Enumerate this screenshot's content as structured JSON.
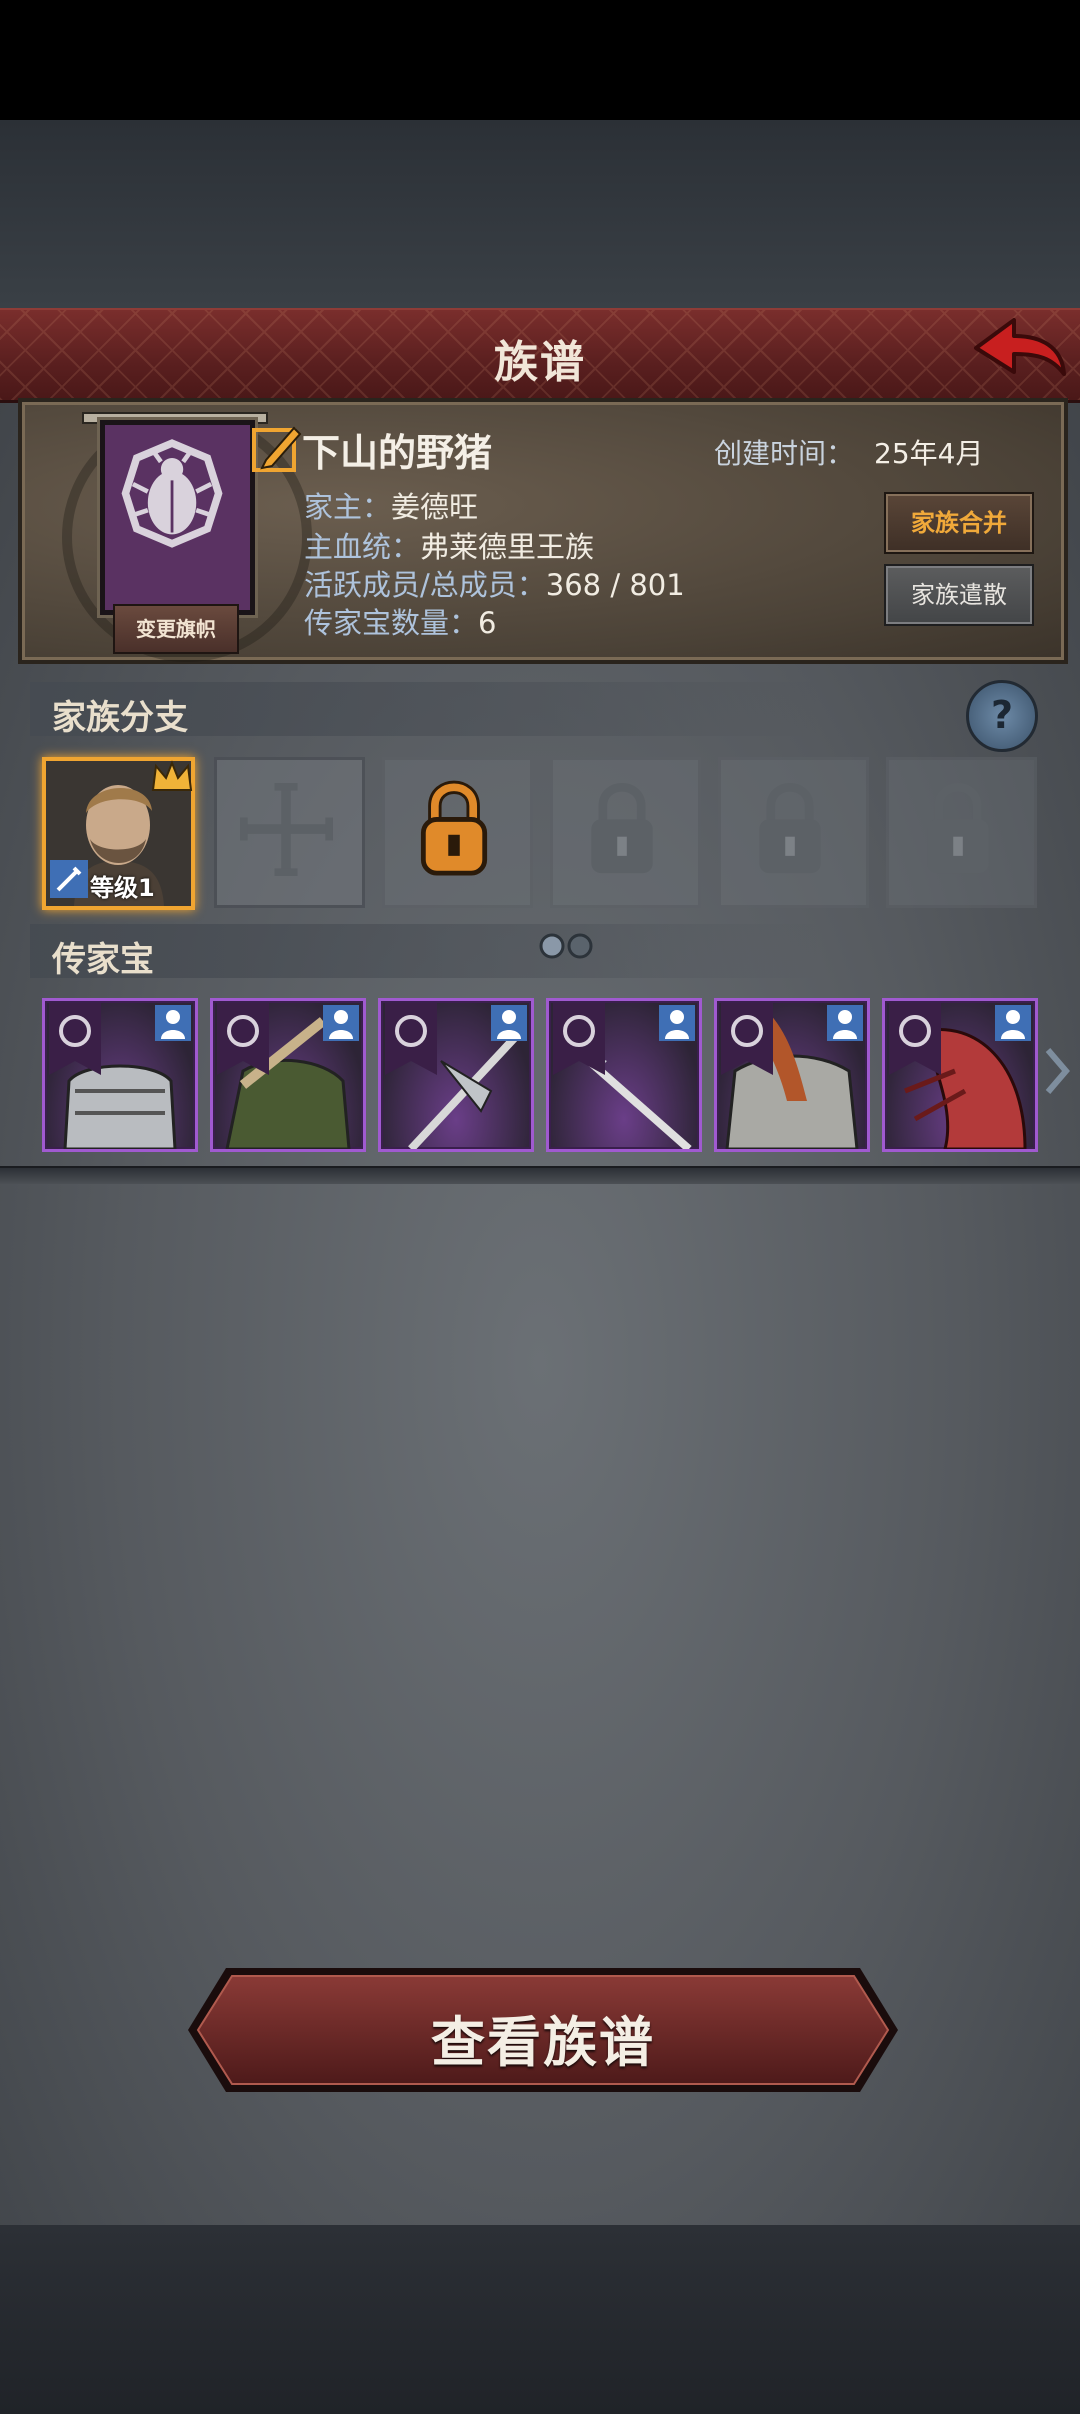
{
  "header": {
    "title": "族谱"
  },
  "family": {
    "banner_button_label": "变更旗帜",
    "name": "下山的野猪",
    "created_label": "创建时间：",
    "created_value": "25年4月",
    "head_label": "家主：",
    "head_value": "姜德旺",
    "bloodline_label": "主血统：",
    "bloodline_value": "弗莱德里王族",
    "members_label": "活跃成员/总成员：",
    "members_value": "368 / 801",
    "heirloom_count_label": "传家宝数量：",
    "heirloom_count_value": "6",
    "merge_button_label": "家族合并",
    "disband_button_label": "家族遣散"
  },
  "branches": {
    "section_title": "家族分支",
    "help_label": "?",
    "leader_level": "等级1",
    "slots": [
      "leader",
      "empty",
      "locked-available",
      "locked",
      "locked",
      "locked"
    ]
  },
  "heirlooms": {
    "section_title": "传家宝",
    "items": [
      "plate-armor",
      "fur-cloak-with-club",
      "halberd",
      "spear",
      "chainmail-with-scarf",
      "red-feather-cape"
    ]
  },
  "footer": {
    "view_button_label": "查看族谱"
  },
  "colors": {
    "accent_gold": "#f0a531",
    "rarity_purple": "#a05ad0",
    "banner_red": "#6a2727",
    "label_blue": "#aec3dc"
  }
}
